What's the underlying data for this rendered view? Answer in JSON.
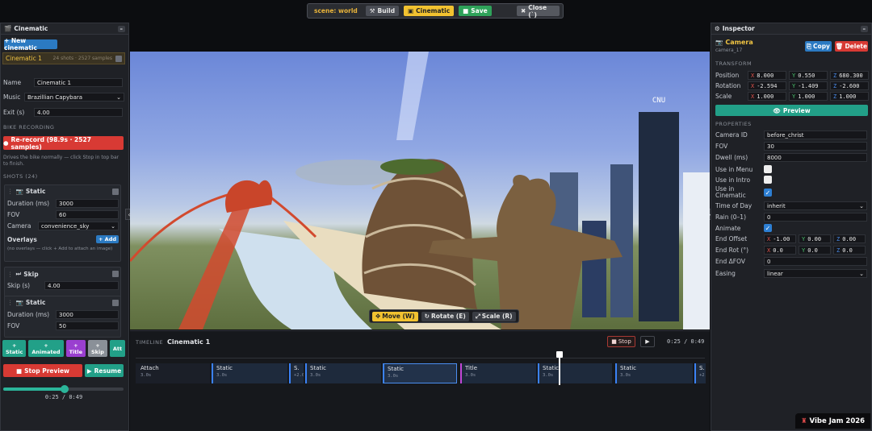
{
  "topbar": {
    "scene": "scene: world",
    "build": "Build",
    "cinematic": "Cinematic",
    "save": "Save",
    "close": "Close (`)"
  },
  "left": {
    "title": "Cinematic",
    "minimize": "–",
    "new_cinematic": "+ New cinematic",
    "cinematic_item": {
      "name": "Cinematic 1",
      "meta": "24 shots · 2527 samples"
    },
    "name_label": "Name",
    "name_value": "Cinematic 1",
    "music_label": "Music",
    "music_value": "Brazillian Capybara",
    "exit_label": "Exit (s)",
    "exit_value": "4.00",
    "bike_section": "BIKE RECORDING",
    "rerecord": "Re-record (98.9s · 2527 samples)",
    "bike_hint": "Drives the bike normally — click Stop in top bar to finish.",
    "shots_section": "SHOTS (24)",
    "shot1": {
      "title": "Static",
      "duration_label": "Duration (ms)",
      "duration_value": "3000",
      "fov_label": "FOV",
      "fov_value": "60",
      "camera_label": "Camera",
      "camera_value": "convenience_sky",
      "overlays_label": "Overlays",
      "add_label": "+ Add",
      "overlays_hint": "(no overlays — click + Add to attach an image)"
    },
    "shot2": {
      "title": "Skip",
      "skip_label": "Skip (s)",
      "skip_value": "4.00"
    },
    "shot3": {
      "title": "Static",
      "duration_label": "Duration (ms)",
      "duration_value": "3000",
      "fov_label": "FOV",
      "fov_value": "50"
    },
    "add_buttons": [
      {
        "label": "+\nStatic",
        "color": "#22a088"
      },
      {
        "label": "+\nAnimated",
        "color": "#22a088"
      },
      {
        "label": "+\nTitle",
        "color": "#9a3fd0"
      },
      {
        "label": "+\nSkip",
        "color": "#8a9098"
      },
      {
        "label": "Att",
        "color": "#22a088"
      }
    ],
    "stop_preview": "Stop Preview",
    "resume": "Resume",
    "progress": 0.51,
    "time": "0:25 / 0:49"
  },
  "viewport": {
    "tools": [
      {
        "label": "Move (W)",
        "active": true
      },
      {
        "label": "Rotate (E)",
        "active": false
      },
      {
        "label": "Scale (R)",
        "active": false
      }
    ],
    "building_sign": "CNU"
  },
  "timeline": {
    "label": "TIMELINE",
    "name": "Cinematic 1",
    "stop": "Stop",
    "play": "▶",
    "time": "0:25 / 0:49",
    "segments": [
      {
        "title": "Attach",
        "dur": "3.0s"
      },
      {
        "title": "Static",
        "dur": "3.0s"
      },
      {
        "title": "S.",
        "dur": "+2.0"
      },
      {
        "title": "Static",
        "dur": "3.0s"
      },
      {
        "title": "Static",
        "dur": "3.0s"
      },
      {
        "title": "Title",
        "dur": "3.0s"
      },
      {
        "title": "Static",
        "dur": "3.0s"
      },
      {
        "title": "Static",
        "dur": "3.0s"
      },
      {
        "title": "S.",
        "dur": "+2.0"
      }
    ]
  },
  "inspector": {
    "title": "Inspector",
    "minimize": "–",
    "object_name": "Camera",
    "object_id": "camera_17",
    "copy": "Copy",
    "delete": "Delete",
    "transform_section": "TRANSFORM",
    "position": {
      "label": "Position",
      "x": "8.000",
      "y": "0.550",
      "z": "680.300"
    },
    "rotation": {
      "label": "Rotation",
      "x": "-2.594",
      "y": "-1.409",
      "z": "-2.600"
    },
    "scale": {
      "label": "Scale",
      "x": "1.000",
      "y": "1.000",
      "z": "1.000"
    },
    "preview": "Preview",
    "properties_section": "PROPERTIES",
    "camera_id": {
      "label": "Camera ID",
      "value": "before_christ"
    },
    "fov": {
      "label": "FOV",
      "value": "30"
    },
    "dwell": {
      "label": "Dwell (ms)",
      "value": "8000"
    },
    "use_in_menu": {
      "label": "Use in Menu",
      "checked": false
    },
    "use_in_intro": {
      "label": "Use in Intro",
      "checked": false
    },
    "use_in_cinematic": {
      "label": "Use in Cinematic",
      "checked": true
    },
    "time_of_day": {
      "label": "Time of Day",
      "value": "inherit"
    },
    "rain": {
      "label": "Rain (0–1)",
      "value": "0"
    },
    "animate": {
      "label": "Animate",
      "checked": true
    },
    "end_offset": {
      "label": "End Offset",
      "x": "-1.00",
      "y": "0.00",
      "z": "0.00"
    },
    "end_rot": {
      "label": "End Rot (°)",
      "x": "0.0",
      "y": "0.0",
      "z": "0.0"
    },
    "end_dfov": {
      "label": "End ΔFOV",
      "value": "0"
    },
    "easing": {
      "label": "Easing",
      "value": "linear"
    }
  },
  "badge": "Vibe Jam 2026"
}
